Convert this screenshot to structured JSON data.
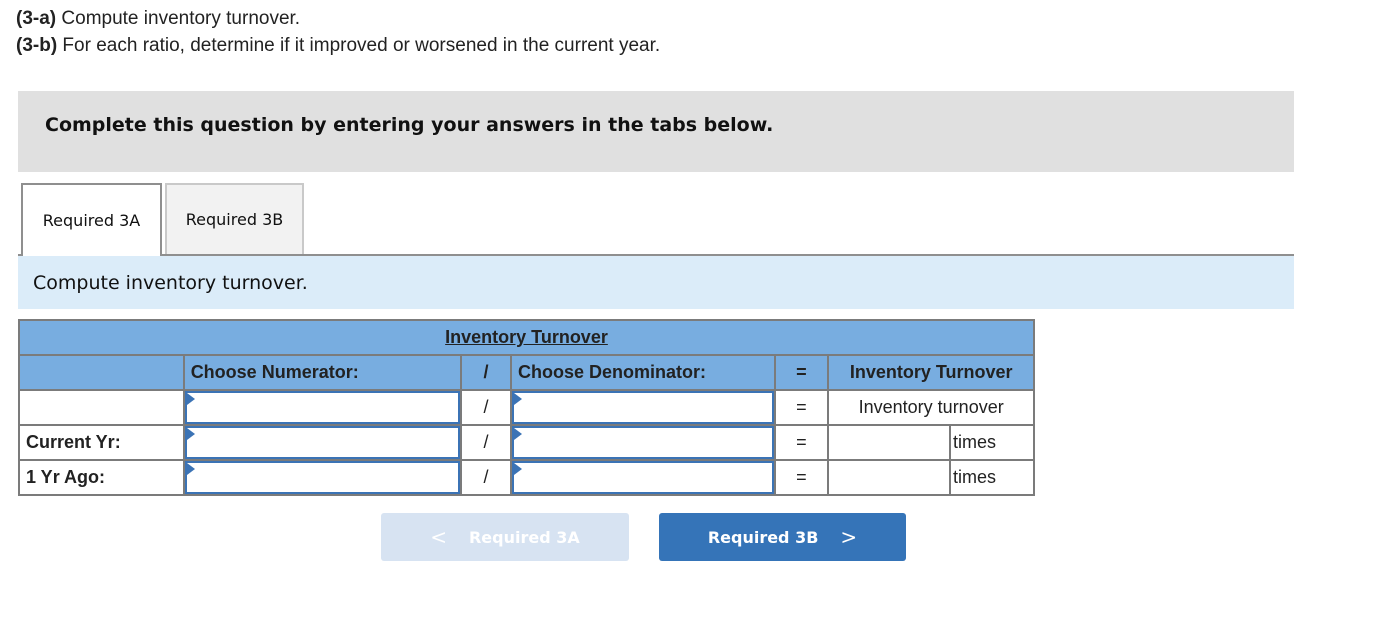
{
  "instructions": [
    {
      "tag": "(3-a)",
      "text": " Compute inventory turnover."
    },
    {
      "tag": "(3-b)",
      "text": " For each ratio, determine if it improved or worsened in the current year."
    }
  ],
  "banner": "Complete this question by entering your answers in the tabs below.",
  "tabs": [
    {
      "label": "Required 3A",
      "active": true
    },
    {
      "label": "Required 3B",
      "active": false
    }
  ],
  "subheading": "Compute inventory turnover.",
  "table": {
    "title": "Inventory Turnover",
    "headers": {
      "numerator": "Choose Numerator:",
      "divide": "/",
      "denominator": "Choose Denominator:",
      "equals": "=",
      "result": "Inventory Turnover"
    },
    "rows": [
      {
        "label": "",
        "numerator": "",
        "divide": "/",
        "denominator": "",
        "equals": "=",
        "result_label": "Inventory turnover"
      },
      {
        "label": "Current Yr:",
        "numerator": "",
        "divide": "/",
        "denominator": "",
        "equals": "=",
        "value": "",
        "unit": "times"
      },
      {
        "label": "1 Yr Ago:",
        "numerator": "",
        "divide": "/",
        "denominator": "",
        "equals": "=",
        "value": "",
        "unit": "times"
      }
    ]
  },
  "nav": {
    "prev_label": "Required 3A",
    "prev_icon": "chevron-left-icon",
    "prev_glyph": "<",
    "next_label": "Required 3B",
    "next_icon": "chevron-right-icon",
    "next_glyph": ">"
  }
}
